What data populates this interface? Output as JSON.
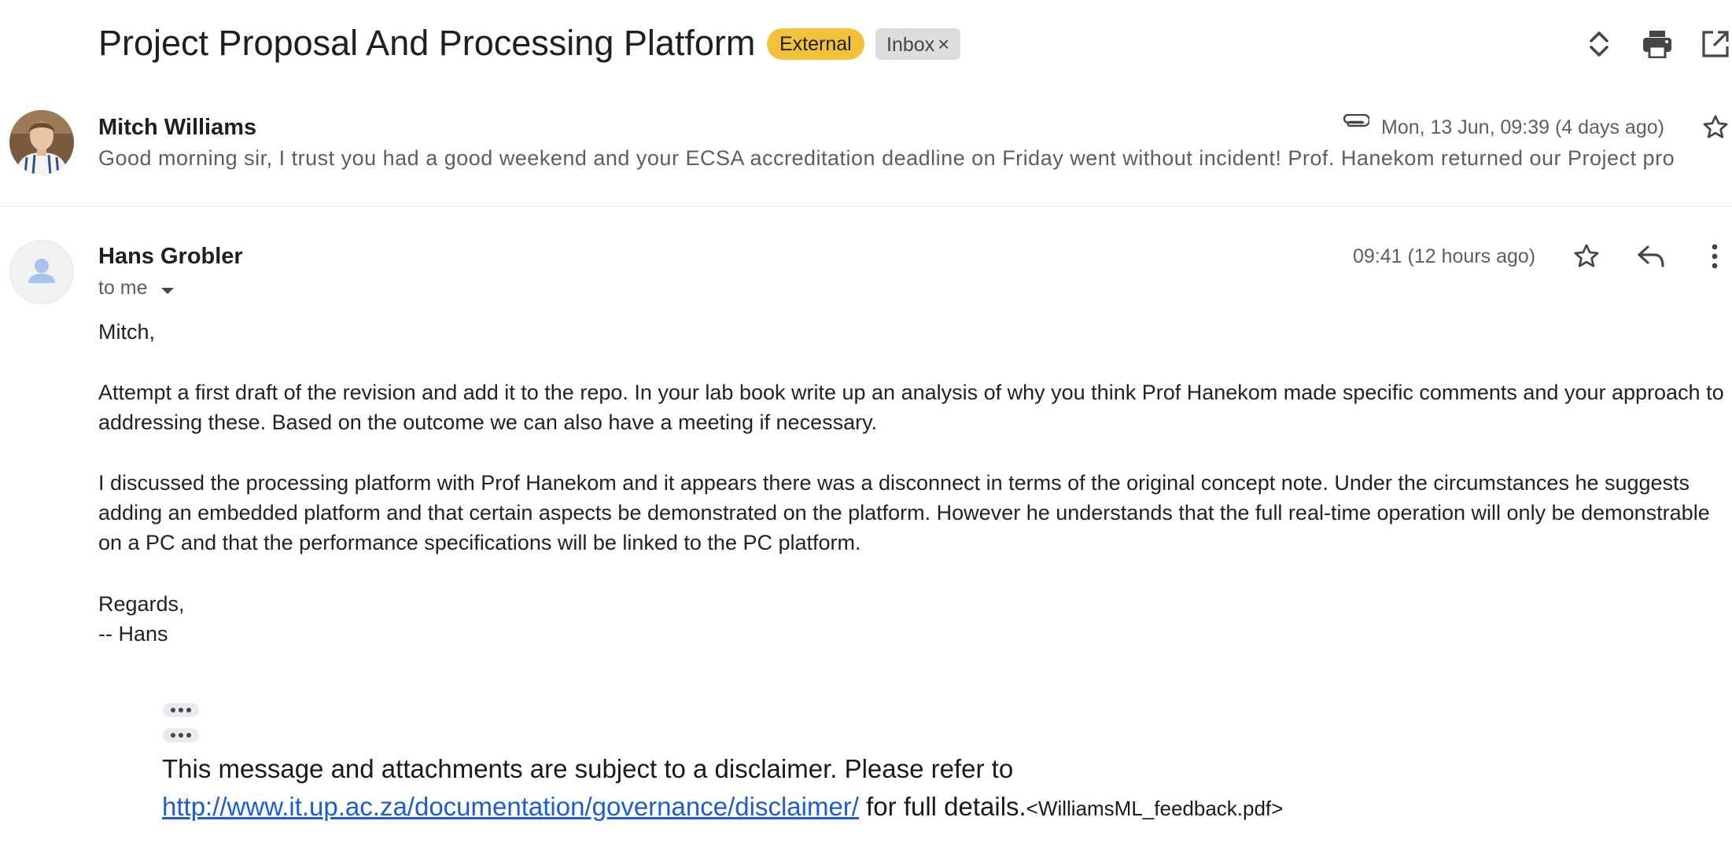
{
  "thread": {
    "subject": "Project Proposal And Processing Platform",
    "labels": {
      "external": "External",
      "inbox": "Inbox",
      "inbox_remove": "×"
    },
    "header_icons": [
      "expand-collapse-icon",
      "print-icon",
      "open-new-window-icon"
    ]
  },
  "messages": [
    {
      "state": "collapsed",
      "sender": "Mitch Williams",
      "date": "Mon, 13 Jun, 09:39 (4 days ago)",
      "has_attachment": true,
      "snippet": "Good morning sir, I trust you had a good weekend and your ECSA accreditation deadline on Friday went without incident! Prof. Hanekom returned our Project propos"
    },
    {
      "state": "expanded",
      "sender": "Hans Grobler",
      "date": "09:41 (12 hours ago)",
      "recipient": "to me",
      "body": {
        "greeting": "Mitch,",
        "paragraph1": "Attempt a first draft of the revision and add it to the repo. In your lab book write up an analysis of why you think Prof Hanekom made specific comments and your approach to addressing these. Based on the outcome we can also have a meeting if necessary.",
        "paragraph2": "I discussed the processing platform with Prof Hanekom and it appears there was a disconnect in terms of the original concept note. Under the circumstances he suggests adding an embedded platform and that certain aspects be demonstrated on the platform. However he understands that the full real-time operation will only be demonstrable on a PC and that the performance specifications will be linked to the PC platform.",
        "closing": "Regards,",
        "signature": "-- Hans"
      },
      "disclaimer": {
        "prefix": "This message and attachments are subject to a disclaimer. Please refer to ",
        "link": "http://www.it.up.ac.za/documentation/governance/disclaimer/",
        "suffix": " for full details.",
        "attachment": "<WilliamsML_feedback.pdf>"
      }
    }
  ],
  "colors": {
    "external_label": "#f2c23a",
    "inbox_label": "#dddddd",
    "link": "#1a5dd6",
    "muted_text": "#5e5e5e"
  }
}
